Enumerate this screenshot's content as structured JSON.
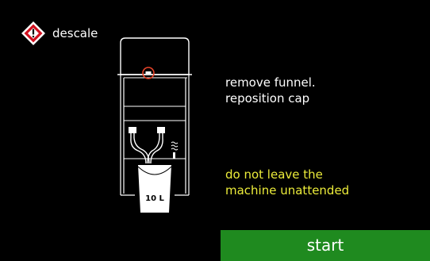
{
  "header": {
    "title": "descale",
    "icon": "warning-diamond-icon"
  },
  "illustration": {
    "bucket_label": "10 L",
    "highlight_color": "#e8442a"
  },
  "instruction": {
    "text": "remove funnel.\nreposition cap"
  },
  "warning": {
    "text": "do not leave the\nmachine unattended",
    "color": "#ecec3a"
  },
  "actions": {
    "start_label": "start",
    "start_color": "#1f8a1f"
  }
}
